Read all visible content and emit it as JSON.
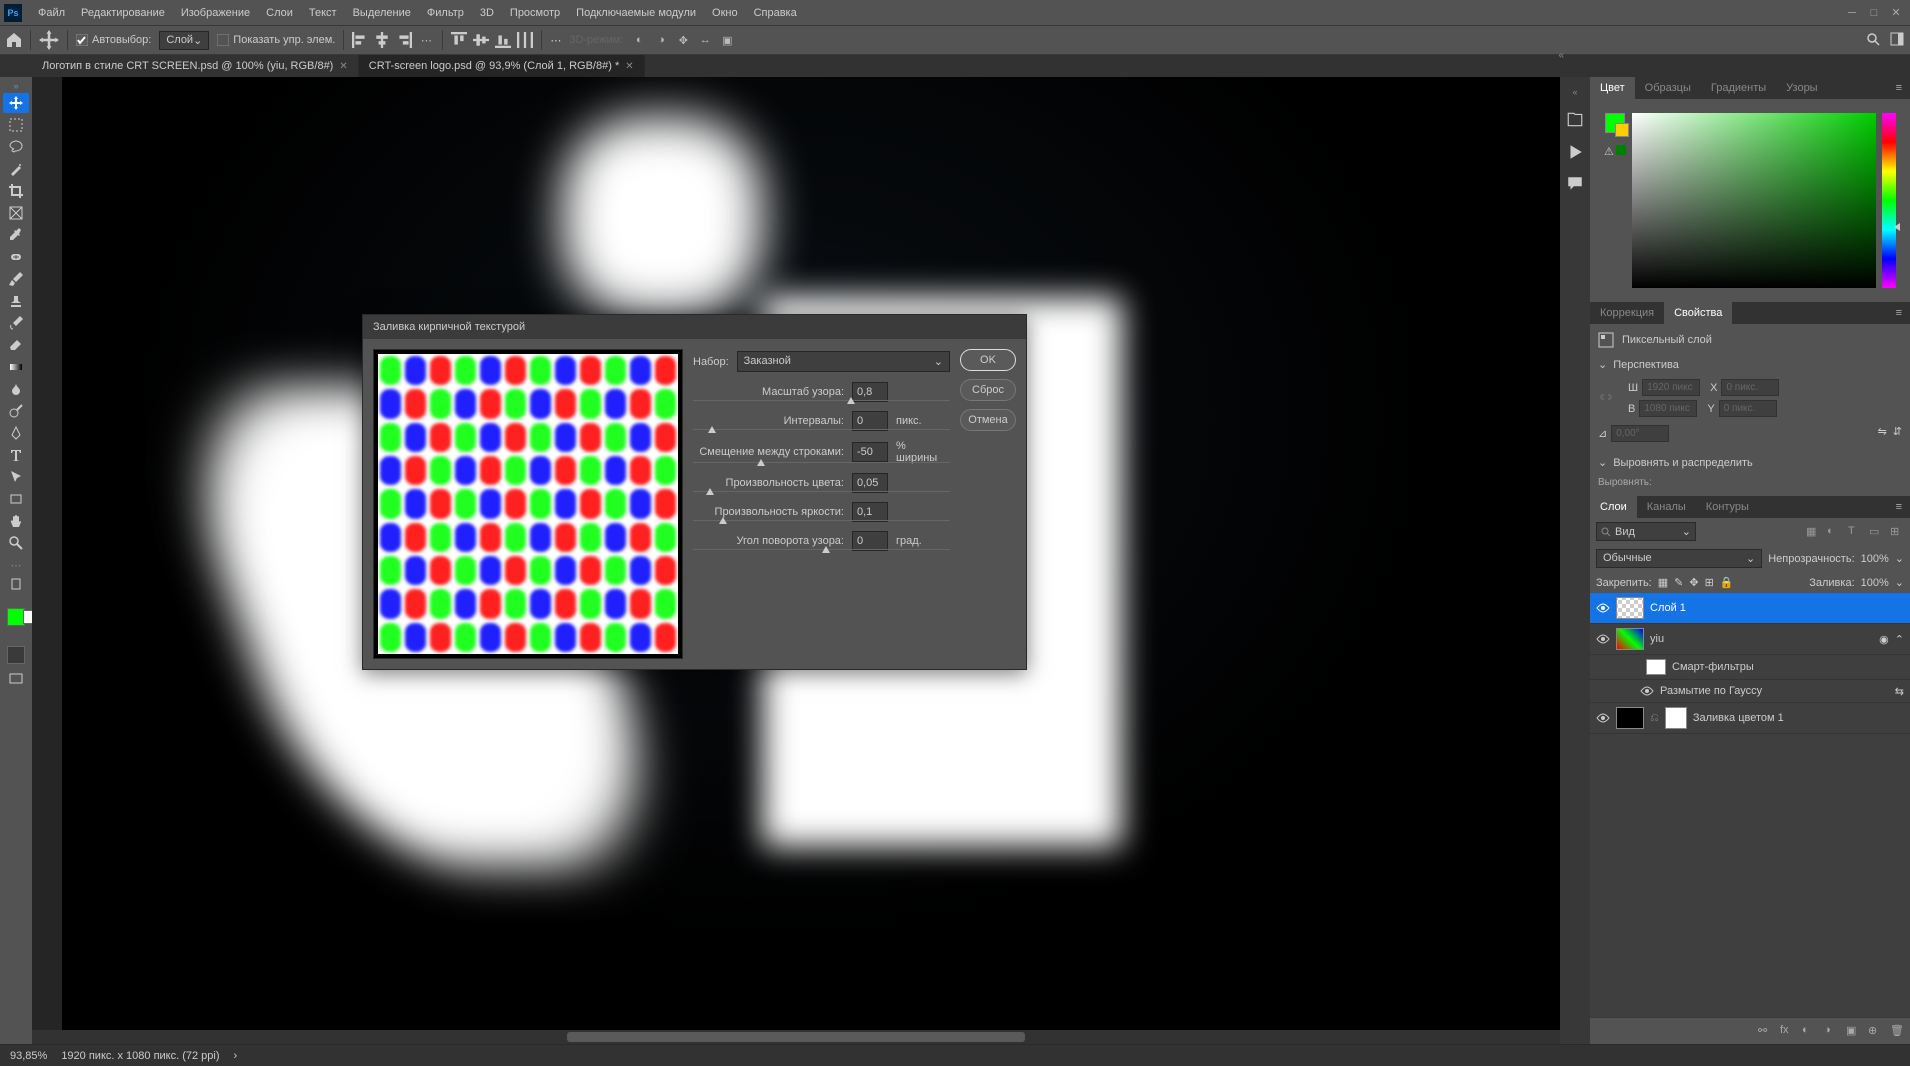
{
  "menu": {
    "items": [
      "Файл",
      "Редактирование",
      "Изображение",
      "Слои",
      "Текст",
      "Выделение",
      "Фильтр",
      "3D",
      "Просмотр",
      "Подключаемые модули",
      "Окно",
      "Справка"
    ]
  },
  "optionsBar": {
    "autoSelectLabel": "Автовыбор:",
    "autoSelectValue": "Слой",
    "showTransformLabel": "Показать упр. элем.",
    "mode3d": "3D-режим:"
  },
  "tabs": [
    {
      "label": "Логотип в стиле CRT SCREEN.psd @ 100% (yiu, RGB/8#)",
      "active": false
    },
    {
      "label": "CRT-screen logo.psd @ 93,9% (Слой 1, RGB/8#) *",
      "active": true
    }
  ],
  "dialog": {
    "title": "Заливка кирпичной текстурой",
    "setLabel": "Набор:",
    "setValue": "Заказной",
    "ok": "OK",
    "reset": "Сброс",
    "cancel": "Отмена",
    "fields": {
      "patternScale": {
        "label": "Масштаб узора:",
        "value": "0,8",
        "unit": ""
      },
      "spacing": {
        "label": "Интервалы:",
        "value": "0",
        "unit": "пикс."
      },
      "rowOffset": {
        "label": "Смещение между строками:",
        "value": "-50",
        "unit": "% ширины"
      },
      "colorRandom": {
        "label": "Произвольность цвета:",
        "value": "0,05",
        "unit": ""
      },
      "brightRandom": {
        "label": "Произвольность яркости:",
        "value": "0,1",
        "unit": ""
      },
      "rotation": {
        "label": "Угол поворота узора:",
        "value": "0",
        "unit": "град."
      }
    }
  },
  "rightPanels": {
    "colorTabs": [
      "Цвет",
      "Образцы",
      "Градиенты",
      "Узоры"
    ],
    "correctionsTabs": [
      "Коррекция",
      "Свойства"
    ],
    "pixelLayerLabel": "Пиксельный слой",
    "perspectiveLabel": "Перспектива",
    "alignLabel": "Выровнять и распределить",
    "alignByLabel": "Выровнять:",
    "dims": {
      "wLabel": "Ш",
      "wVal": "1920 пикс",
      "hLabel": "В",
      "hVal": "1080 пикс",
      "xLabel": "X",
      "xVal": "0 пикс.",
      "yLabel": "Y",
      "yVal": "0 пикс.",
      "angleLabel": "0,00°"
    },
    "layerTabs": [
      "Слои",
      "Каналы",
      "Контуры"
    ],
    "layerSearch": "Вид",
    "blendMode": "Обычные",
    "opacityLabel": "Непрозрачность:",
    "opacityVal": "100%",
    "lockLabel": "Закрепить:",
    "fillLabel": "Заливка:",
    "fillVal": "100%",
    "layers": [
      {
        "name": "Слой 1",
        "selected": true,
        "thumb": "checker"
      },
      {
        "name": "yiu",
        "selected": false,
        "smart": true
      },
      {
        "name": "Смарт-фильтры",
        "sub": true
      },
      {
        "name": "Размытие по Гауссу",
        "sub": true,
        "sub2": true
      },
      {
        "name": "Заливка цветом 1",
        "selected": false,
        "fill": true
      }
    ]
  },
  "statusBar": {
    "zoom": "93,85%",
    "docInfo": "1920 пикс. x 1080 пикс. (72 ppi)"
  }
}
